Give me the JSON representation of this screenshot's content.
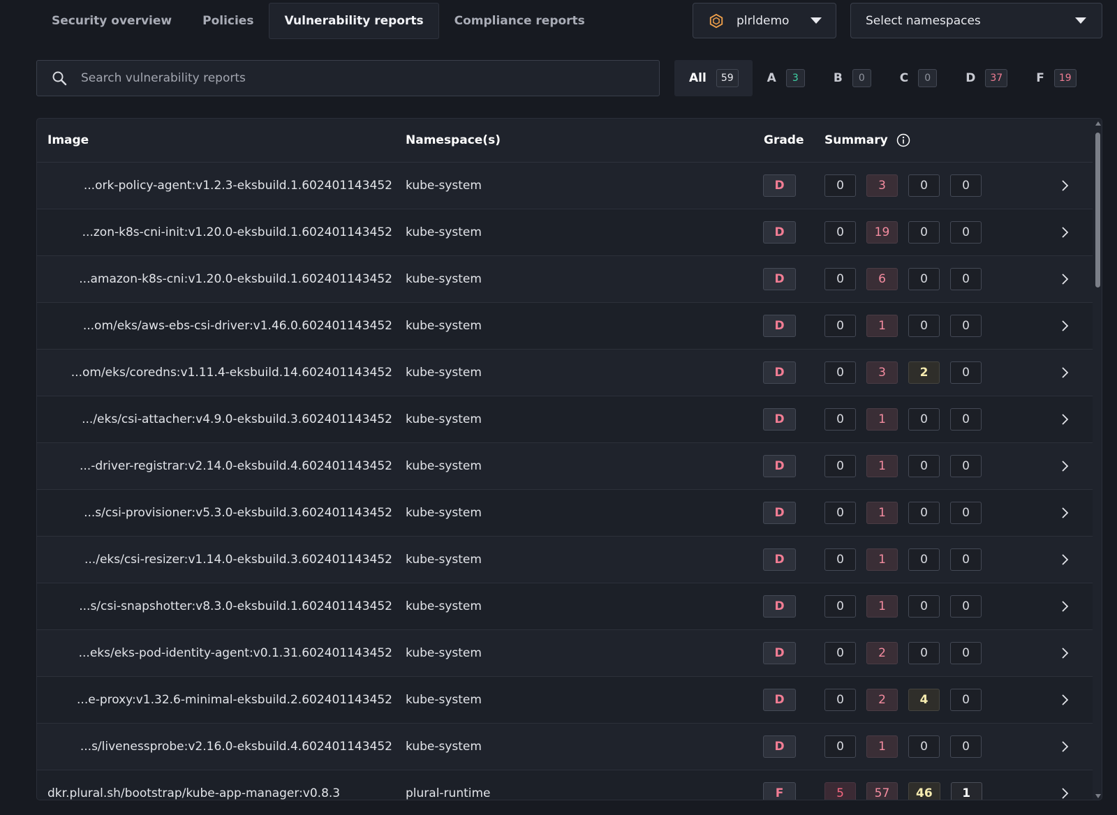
{
  "tabs": [
    {
      "label": "Security overview",
      "active": false
    },
    {
      "label": "Policies",
      "active": false
    },
    {
      "label": "Vulnerability reports",
      "active": true
    },
    {
      "label": "Compliance reports",
      "active": false
    }
  ],
  "cluster_select": {
    "value": "plrldemo",
    "icon": "cluster-hexagon-icon"
  },
  "namespace_select": {
    "value": "Select namespaces"
  },
  "search": {
    "placeholder": "Search vulnerability reports",
    "value": ""
  },
  "grade_filters": [
    {
      "label": "All",
      "count": "59",
      "active": true,
      "tone": "neutral"
    },
    {
      "label": "A",
      "count": "3",
      "active": false,
      "tone": "green"
    },
    {
      "label": "B",
      "count": "0",
      "active": false,
      "tone": "gray"
    },
    {
      "label": "C",
      "count": "0",
      "active": false,
      "tone": "gray"
    },
    {
      "label": "D",
      "count": "37",
      "active": false,
      "tone": "red"
    },
    {
      "label": "F",
      "count": "19",
      "active": false,
      "tone": "red"
    }
  ],
  "table": {
    "headers": {
      "image": "Image",
      "namespaces": "Namespace(s)",
      "grade": "Grade",
      "summary": "Summary"
    },
    "rows": [
      {
        "image": "...ork-policy-agent:v1.2.3-eksbuild.1.602401143452",
        "namespace": "kube-system",
        "grade": "D",
        "summary": [
          "0",
          "3",
          "0",
          "0"
        ]
      },
      {
        "image": "...zon-k8s-cni-init:v1.20.0-eksbuild.1.602401143452",
        "namespace": "kube-system",
        "grade": "D",
        "summary": [
          "0",
          "19",
          "0",
          "0"
        ]
      },
      {
        "image": "...amazon-k8s-cni:v1.20.0-eksbuild.1.602401143452",
        "namespace": "kube-system",
        "grade": "D",
        "summary": [
          "0",
          "6",
          "0",
          "0"
        ]
      },
      {
        "image": "...om/eks/aws-ebs-csi-driver:v1.46.0.602401143452",
        "namespace": "kube-system",
        "grade": "D",
        "summary": [
          "0",
          "1",
          "0",
          "0"
        ]
      },
      {
        "image": "...om/eks/coredns:v1.11.4-eksbuild.14.602401143452",
        "namespace": "kube-system",
        "grade": "D",
        "summary": [
          "0",
          "3",
          "2",
          "0"
        ]
      },
      {
        "image": ".../eks/csi-attacher:v4.9.0-eksbuild.3.602401143452",
        "namespace": "kube-system",
        "grade": "D",
        "summary": [
          "0",
          "1",
          "0",
          "0"
        ]
      },
      {
        "image": "...-driver-registrar:v2.14.0-eksbuild.4.602401143452",
        "namespace": "kube-system",
        "grade": "D",
        "summary": [
          "0",
          "1",
          "0",
          "0"
        ]
      },
      {
        "image": "...s/csi-provisioner:v5.3.0-eksbuild.3.602401143452",
        "namespace": "kube-system",
        "grade": "D",
        "summary": [
          "0",
          "1",
          "0",
          "0"
        ]
      },
      {
        "image": ".../eks/csi-resizer:v1.14.0-eksbuild.3.602401143452",
        "namespace": "kube-system",
        "grade": "D",
        "summary": [
          "0",
          "1",
          "0",
          "0"
        ]
      },
      {
        "image": "...s/csi-snapshotter:v8.3.0-eksbuild.1.602401143452",
        "namespace": "kube-system",
        "grade": "D",
        "summary": [
          "0",
          "1",
          "0",
          "0"
        ]
      },
      {
        "image": "...eks/eks-pod-identity-agent:v0.1.31.602401143452",
        "namespace": "kube-system",
        "grade": "D",
        "summary": [
          "0",
          "2",
          "0",
          "0"
        ]
      },
      {
        "image": "...e-proxy:v1.32.6-minimal-eksbuild.2.602401143452",
        "namespace": "kube-system",
        "grade": "D",
        "summary": [
          "0",
          "2",
          "4",
          "0"
        ]
      },
      {
        "image": "...s/livenessprobe:v2.16.0-eksbuild.4.602401143452",
        "namespace": "kube-system",
        "grade": "D",
        "summary": [
          "0",
          "1",
          "0",
          "0"
        ]
      },
      {
        "image": "dkr.plural.sh/bootstrap/kube-app-manager:v0.8.3",
        "namespace": "plural-runtime",
        "grade": "F",
        "summary": [
          "5",
          "57",
          "46",
          "1"
        ]
      }
    ]
  },
  "colors": {
    "background": "#171a21",
    "surface": "#1f232c",
    "grade_red": "#f27d94",
    "critical": "#f5667f",
    "high": "#f58ca0",
    "medium": "#f7ecb0",
    "success_green": "#3fd4a6",
    "cluster_icon_orange": "#f0a04b"
  }
}
